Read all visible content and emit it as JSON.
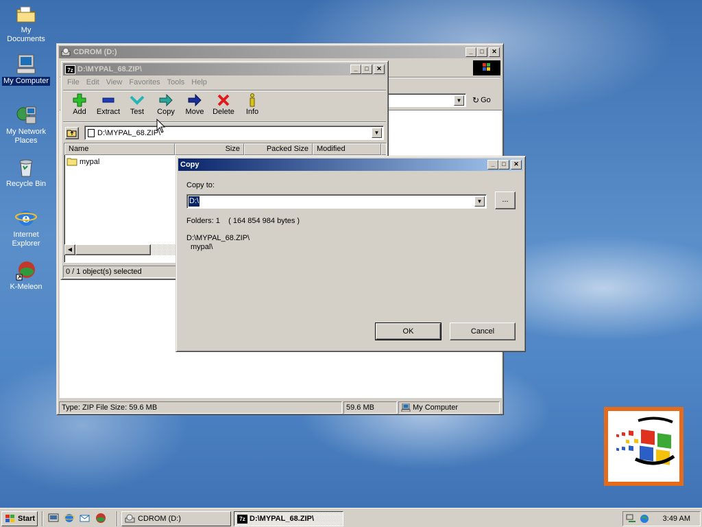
{
  "desktop": {
    "icons": [
      {
        "label": "My Documents",
        "icon": "folder-documents-icon"
      },
      {
        "label": "My Computer",
        "icon": "computer-icon"
      },
      {
        "label": "My Network Places",
        "icon": "network-icon"
      },
      {
        "label": "Recycle Bin",
        "icon": "recycle-bin-icon"
      },
      {
        "label": "Internet Explorer",
        "icon": "internet-explorer-icon"
      },
      {
        "label": "K-Meleon",
        "icon": "k-meleon-icon"
      }
    ]
  },
  "cdrom_window": {
    "title": "CDROM (D:)",
    "go_label": "Go",
    "status": {
      "type_size": "Type: ZIP File Size: 59.6 MB",
      "size": "59.6 MB",
      "location": "My Computer"
    }
  },
  "zip_window": {
    "title": "D:\\MYPAL_68.ZIP\\",
    "menu": [
      "File",
      "Edit",
      "View",
      "Favorites",
      "Tools",
      "Help"
    ],
    "toolbar": [
      "Add",
      "Extract",
      "Test",
      "Copy",
      "Move",
      "Delete",
      "Info"
    ],
    "address": "D:\\MYPAL_68.ZIP\\",
    "columns": [
      "Name",
      "Size",
      "Packed Size",
      "Modified"
    ],
    "rows": [
      {
        "name": "mypal"
      }
    ],
    "status": "0 / 1 object(s) selected"
  },
  "copy_dialog": {
    "title": "Copy",
    "copy_to_label": "Copy to:",
    "destination": "D:\\",
    "browse_label": "...",
    "folders_info": "Folders: 1    ( 164 854 984 bytes )",
    "source_path": "D:\\MYPAL_68.ZIP\\",
    "source_item": "mypal\\",
    "ok_label": "OK",
    "cancel_label": "Cancel"
  },
  "taskbar": {
    "start_label": "Start",
    "tasks": [
      {
        "label": "CDROM (D:)",
        "active": false
      },
      {
        "label": "D:\\MYPAL_68.ZIP\\",
        "active": true
      }
    ],
    "clock": "3:49 AM"
  },
  "colors": {
    "title_active": "#0a246a",
    "title_inactive": "#808080",
    "face": "#d4d0c8",
    "desktop": "#4f86c6"
  }
}
